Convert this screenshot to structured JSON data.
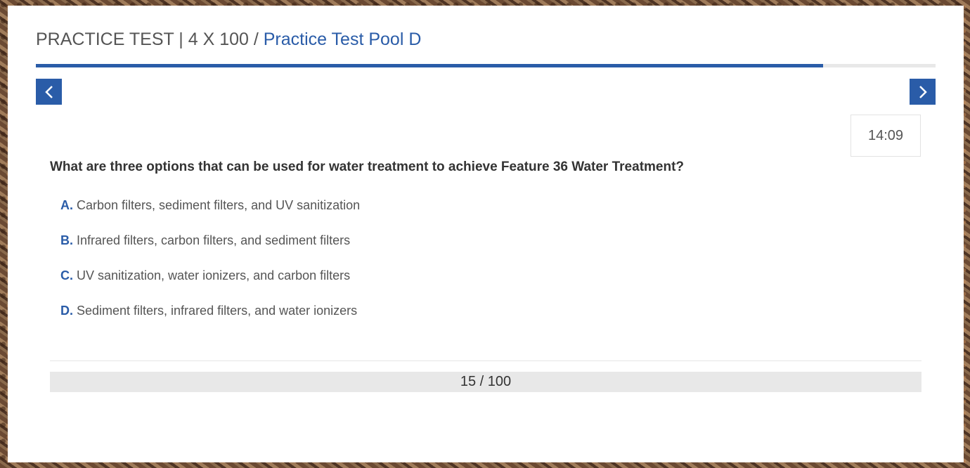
{
  "header": {
    "title_main": "PRACTICE TEST | 4 X 100",
    "title_sep": " / ",
    "title_pool": "Practice Test Pool D"
  },
  "progress": {
    "fraction": 0.875
  },
  "nav": {
    "prev_icon": "chevron-left-icon",
    "next_icon": "chevron-right-icon"
  },
  "timer": {
    "value": "14:09"
  },
  "question": {
    "text": "What are three options that can be used for water treatment to achieve Feature 36 Water Treatment?",
    "options": [
      {
        "letter": "A.",
        "text": "Carbon filters, sediment filters, and UV sanitization"
      },
      {
        "letter": "B.",
        "text": "Infrared filters, carbon filters, and sediment filters"
      },
      {
        "letter": "C.",
        "text": "UV sanitization, water ionizers, and carbon filters"
      },
      {
        "letter": "D.",
        "text": "Sediment filters, infrared filters, and water ionizers"
      }
    ]
  },
  "counter": {
    "text": "15 / 100"
  },
  "colors": {
    "accent": "#2a5ca8",
    "text": "#555555",
    "track": "#e8e8e8"
  }
}
